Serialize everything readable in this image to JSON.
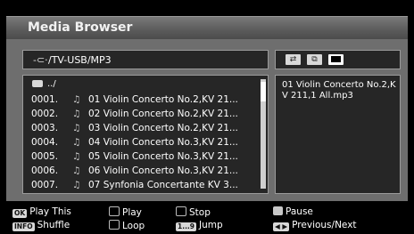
{
  "window": {
    "title": "Media Browser"
  },
  "path": {
    "usb_icon": "usb-icon",
    "value": "/TV-USB/MP3"
  },
  "list": {
    "parent_label": "../",
    "rows": [
      {
        "num": "0001.",
        "name": "01 Violin Concerto No.2,KV 21..."
      },
      {
        "num": "0002.",
        "name": "02 Violin Concerto No.2,KV 21..."
      },
      {
        "num": "0003.",
        "name": "03 Violin Concerto No.2,KV 21..."
      },
      {
        "num": "0004.",
        "name": "04 Violin Concerto No.3,KV 21..."
      },
      {
        "num": "0005.",
        "name": "05 Violin Concerto No.3,KV 21..."
      },
      {
        "num": "0006.",
        "name": "06 Violin Concerto No.3,KV 21..."
      },
      {
        "num": "0007.",
        "name": "07 Synfonia Concertante KV 3..."
      }
    ]
  },
  "preview": {
    "filename": "01 Violin Concerto No.2,KV 211,1 All.mp3"
  },
  "legend": {
    "ok_key": "OK",
    "play_this": "Play This",
    "play": "Play",
    "stop": "Stop",
    "pause": "Pause",
    "info_key": "INFO",
    "shuffle": "Shuffle",
    "loop": "Loop",
    "jump_key": "1...9",
    "jump": "Jump",
    "nav_key": "◀ ▶",
    "prev_next": "Previous/Next"
  },
  "colors": {
    "background": "#000000",
    "panel": "#6e6e6e",
    "box": "#262626",
    "title_bar": "#5c5c5c"
  }
}
